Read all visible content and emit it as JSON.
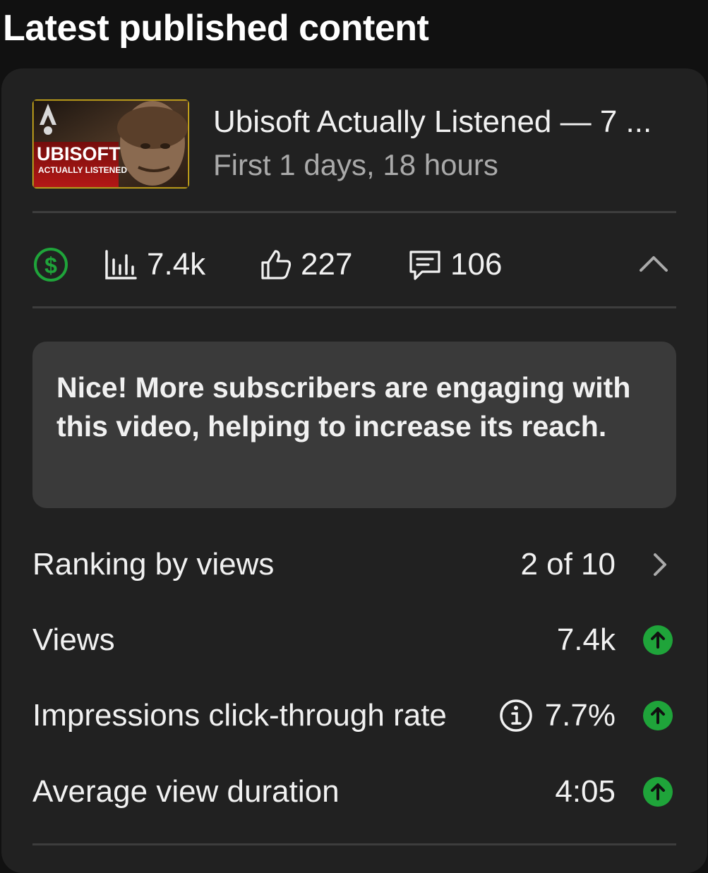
{
  "section": {
    "title": "Latest published content"
  },
  "video": {
    "title": "Ubisoft Actually Listened — 7 ...",
    "subtitle": "First 1 days, 18 hours",
    "thumbnail": {
      "text_main": "UBISOFT",
      "text_sub": "ACTUALLY LISTENED"
    }
  },
  "stats": {
    "views": "7.4k",
    "likes": "227",
    "comments": "106",
    "monetization_icon": "dollar-circle-icon",
    "collapse_icon": "chevron-up-icon"
  },
  "message": "Nice! More subscribers are engaging with this video, helping to increase its reach.",
  "metrics": [
    {
      "label": "Ranking by views",
      "value": "2 of 10",
      "indicator": "chevron-right-icon"
    },
    {
      "label": "Views",
      "value": "7.4k",
      "indicator": "arrow-up-circle-icon"
    },
    {
      "label": "Impressions click-through rate",
      "value": "7.7%",
      "indicator": "arrow-up-circle-icon",
      "info": true
    },
    {
      "label": "Average view duration",
      "value": "4:05",
      "indicator": "arrow-up-circle-icon"
    }
  ],
  "colors": {
    "background": "#111111",
    "card": "#212121",
    "message_box": "#3a3a3a",
    "positive": "#1fa43a",
    "secondary_text": "#aaaaaa"
  }
}
